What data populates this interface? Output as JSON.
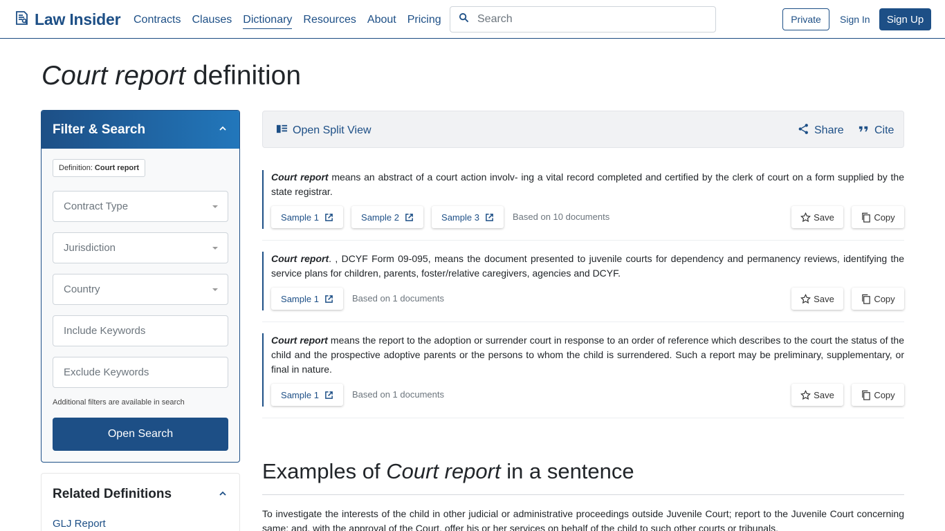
{
  "header": {
    "logo_text": "Law Insider",
    "nav": [
      "Contracts",
      "Clauses",
      "Dictionary",
      "Resources",
      "About",
      "Pricing"
    ],
    "active_nav": "Dictionary",
    "search_placeholder": "Search",
    "private_label": "Private",
    "signin_label": "Sign In",
    "signup_label": "Sign Up"
  },
  "title": {
    "term": "Court report",
    "suffix": "definition"
  },
  "filter": {
    "heading": "Filter & Search",
    "chip_prefix": "Definition:",
    "chip_value": "Court report",
    "contract_type": "Contract Type",
    "jurisdiction": "Jurisdiction",
    "country": "Country",
    "include_placeholder": "Include Keywords",
    "exclude_placeholder": "Exclude Keywords",
    "note": "Additional filters are available in search",
    "open_search_label": "Open Search"
  },
  "related": {
    "heading": "Related Definitions",
    "first_link": "GLJ Report"
  },
  "toolbar": {
    "split_view_label": "Open Split View",
    "share_label": "Share",
    "cite_label": "Cite"
  },
  "definitions": [
    {
      "term": "Court report",
      "text": " means an abstract of a court action involv- ing a vital record completed and certified by the clerk of court on a form supplied by the state registrar.",
      "samples": [
        "Sample 1",
        "Sample 2",
        "Sample 3"
      ],
      "based_on": "Based on 10 documents"
    },
    {
      "term": "Court report",
      "text": ". , DCYF Form 09-095, means the document presented to juvenile courts for dependency and permanency reviews, identifying the service plans for children, parents, foster/relative caregivers, agencies and DCYF.",
      "samples": [
        "Sample 1"
      ],
      "based_on": "Based on 1 documents"
    },
    {
      "term": "Court report",
      "text": " means the report to the adoption or surrender court in response to an order of reference which describes to the court the status of the child and the prospective adoptive parents or the persons to whom the child is surrendered. Such a report may be preliminary, supplementary, or final in nature.",
      "samples": [
        "Sample 1"
      ],
      "based_on": "Based on 1 documents"
    }
  ],
  "actions": {
    "save_label": "Save",
    "copy_label": "Copy"
  },
  "examples": {
    "prefix": "Examples of",
    "term": "Court report",
    "suffix": "in a sentence",
    "first_sentence": "To investigate the interests of the child in other judicial or administrative proceedings outside Juvenile Court; report to the Juvenile Court concerning same; and, with the approval of the Court, offer his or her services on behalf of the child to such other courts or tribunals."
  },
  "icons": {
    "logo": "book-search-icon",
    "search": "search-icon",
    "split_view": "split-view-icon",
    "share": "share-icon",
    "cite": "quote-icon",
    "external": "external-link-icon",
    "save": "star-icon",
    "copy": "copy-icon",
    "collapse": "chevron-up-icon"
  },
  "colors": {
    "brand": "#1d4f86",
    "brand_light": "#2277bb",
    "muted": "#6c757d"
  }
}
